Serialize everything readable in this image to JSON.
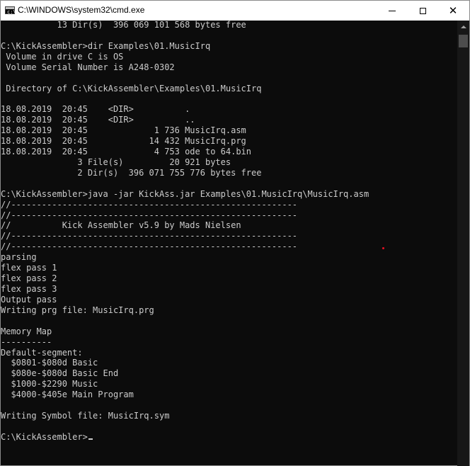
{
  "window": {
    "title": "C:\\WINDOWS\\system32\\cmd.exe",
    "controls": {
      "minimize": "minimize",
      "maximize": "maximize",
      "close": "✕"
    },
    "icon": "console-app-icon",
    "icon_prompt": "c:\\_"
  },
  "colors": {
    "background": "#0c0c0c",
    "text": "#cccccc",
    "titlebar": "#ffffff",
    "accent_dot": "#e81123"
  },
  "console": {
    "lines": [
      "           13 Dir(s)  396 069 101 568 bytes free",
      "",
      "C:\\KickAssembler>dir Examples\\01.MusicIrq",
      " Volume in drive C is OS",
      " Volume Serial Number is A248-0302",
      "",
      " Directory of C:\\KickAssembler\\Examples\\01.MusicIrq",
      "",
      "18.08.2019  20:45    <DIR>          .",
      "18.08.2019  20:45    <DIR>          ..",
      "18.08.2019  20:45             1 736 MusicIrq.asm",
      "18.08.2019  20:45            14 432 MusicIrq.prg",
      "18.08.2019  20:45             4 753 ode to 64.bin",
      "               3 File(s)         20 921 bytes",
      "               2 Dir(s)  396 071 755 776 bytes free",
      "",
      "C:\\KickAssembler>java -jar KickAss.jar Examples\\01.MusicIrq\\MusicIrq.asm",
      "//--------------------------------------------------------",
      "//--------------------------------------------------------",
      "//          Kick Assembler v5.9 by Mads Nielsen",
      "//--------------------------------------------------------",
      "//--------------------------------------------------------",
      "parsing",
      "flex pass 1",
      "flex pass 2",
      "flex pass 3",
      "Output pass",
      "Writing prg file: MusicIrq.prg",
      "",
      "Memory Map",
      "----------",
      "Default-segment:",
      "  $0801-$080d Basic",
      "  $080e-$080d Basic End",
      "  $1000-$2290 Music",
      "  $4000-$405e Main Program",
      "",
      "Writing Symbol file: MusicIrq.sym",
      "",
      "C:\\KickAssembler>"
    ]
  }
}
